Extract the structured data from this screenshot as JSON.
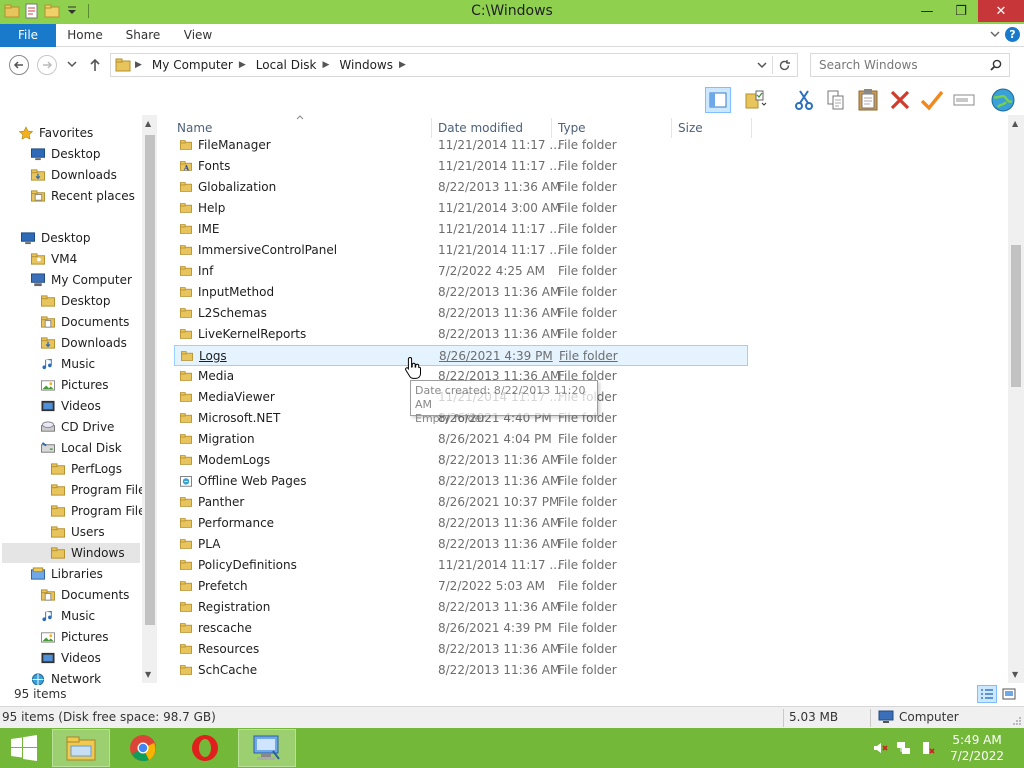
{
  "window": {
    "title": "C:\\Windows",
    "minimize": "—",
    "maximize": "❐",
    "close": "✕"
  },
  "ribbon": {
    "tabs": [
      "File",
      "Home",
      "Share",
      "View"
    ],
    "help": "?"
  },
  "address": {
    "crumbs": [
      "My Computer",
      "Local Disk",
      "Windows"
    ],
    "search_placeholder": "Search Windows"
  },
  "nav": {
    "items": [
      {
        "label": "Favorites",
        "icon": "star-icon"
      },
      {
        "label": "Desktop",
        "icon": "desktop-icon"
      },
      {
        "label": "Downloads",
        "icon": "downloads-icon"
      },
      {
        "label": "Recent places",
        "icon": "recent-places-icon"
      },
      {
        "label": "Desktop",
        "icon": "desktop-icon"
      },
      {
        "label": "VM4",
        "icon": "user-folder-icon"
      },
      {
        "label": "My Computer",
        "icon": "computer-icon"
      },
      {
        "label": "Desktop",
        "icon": "folder-icon"
      },
      {
        "label": "Documents",
        "icon": "documents-icon"
      },
      {
        "label": "Downloads",
        "icon": "downloads-icon"
      },
      {
        "label": "Music",
        "icon": "music-icon"
      },
      {
        "label": "Pictures",
        "icon": "pictures-icon"
      },
      {
        "label": "Videos",
        "icon": "videos-icon"
      },
      {
        "label": "CD Drive",
        "icon": "cd-drive-icon"
      },
      {
        "label": "Local Disk",
        "icon": "disk-icon"
      },
      {
        "label": "PerfLogs",
        "icon": "folder-icon"
      },
      {
        "label": "Program Files",
        "icon": "folder-icon"
      },
      {
        "label": "Program Files",
        "icon": "folder-icon"
      },
      {
        "label": "Users",
        "icon": "folder-icon"
      },
      {
        "label": "Windows",
        "icon": "folder-icon"
      },
      {
        "label": "Libraries",
        "icon": "libraries-icon"
      },
      {
        "label": "Documents",
        "icon": "documents-icon"
      },
      {
        "label": "Music",
        "icon": "music-icon"
      },
      {
        "label": "Pictures",
        "icon": "pictures-icon"
      },
      {
        "label": "Videos",
        "icon": "videos-icon"
      },
      {
        "label": "Network",
        "icon": "network-icon"
      }
    ]
  },
  "columns": {
    "name": "Name",
    "date": "Date modified",
    "type": "Type",
    "size": "Size"
  },
  "files": [
    {
      "name": "FileManager",
      "date": "11/21/2014 11:17 ...",
      "type": "File folder",
      "icon": "folder-icon"
    },
    {
      "name": "Fonts",
      "date": "11/21/2014 11:17 ...",
      "type": "File folder",
      "icon": "fonts-folder-icon"
    },
    {
      "name": "Globalization",
      "date": "8/22/2013 11:36 AM",
      "type": "File folder",
      "icon": "folder-icon"
    },
    {
      "name": "Help",
      "date": "11/21/2014 3:00 AM",
      "type": "File folder",
      "icon": "folder-icon"
    },
    {
      "name": "IME",
      "date": "11/21/2014 11:17 ...",
      "type": "File folder",
      "icon": "folder-icon"
    },
    {
      "name": "ImmersiveControlPanel",
      "date": "11/21/2014 11:17 ...",
      "type": "File folder",
      "icon": "folder-icon"
    },
    {
      "name": "Inf",
      "date": "7/2/2022 4:25 AM",
      "type": "File folder",
      "icon": "folder-icon"
    },
    {
      "name": "InputMethod",
      "date": "8/22/2013 11:36 AM",
      "type": "File folder",
      "icon": "folder-icon"
    },
    {
      "name": "L2Schemas",
      "date": "8/22/2013 11:36 AM",
      "type": "File folder",
      "icon": "folder-icon"
    },
    {
      "name": "LiveKernelReports",
      "date": "8/22/2013 11:36 AM",
      "type": "File folder",
      "icon": "folder-icon"
    },
    {
      "name": "Logs",
      "date": "8/26/2021 4:39 PM",
      "type": "File folder",
      "icon": "folder-icon"
    },
    {
      "name": "Media",
      "date": "8/22/2013 11:36 AM",
      "type": "File folder",
      "icon": "folder-icon"
    },
    {
      "name": "MediaViewer",
      "date": "11/21/2014 11:17 ...",
      "type": "File folder",
      "icon": "folder-icon"
    },
    {
      "name": "Microsoft.NET",
      "date": "8/26/2021 4:40 PM",
      "type": "File folder",
      "icon": "folder-icon"
    },
    {
      "name": "Migration",
      "date": "8/26/2021 4:04 PM",
      "type": "File folder",
      "icon": "folder-icon"
    },
    {
      "name": "ModemLogs",
      "date": "8/22/2013 11:36 AM",
      "type": "File folder",
      "icon": "folder-icon"
    },
    {
      "name": "Offline Web Pages",
      "date": "8/22/2013 11:36 AM",
      "type": "File folder",
      "icon": "offline-pages-icon"
    },
    {
      "name": "Panther",
      "date": "8/26/2021 10:37 PM",
      "type": "File folder",
      "icon": "folder-icon"
    },
    {
      "name": "Performance",
      "date": "8/22/2013 11:36 AM",
      "type": "File folder",
      "icon": "folder-icon"
    },
    {
      "name": "PLA",
      "date": "8/22/2013 11:36 AM",
      "type": "File folder",
      "icon": "folder-icon"
    },
    {
      "name": "PolicyDefinitions",
      "date": "11/21/2014 11:17 ...",
      "type": "File folder",
      "icon": "folder-icon"
    },
    {
      "name": "Prefetch",
      "date": "7/2/2022 5:03 AM",
      "type": "File folder",
      "icon": "folder-icon"
    },
    {
      "name": "Registration",
      "date": "8/22/2013 11:36 AM",
      "type": "File folder",
      "icon": "folder-icon"
    },
    {
      "name": "rescache",
      "date": "8/26/2021 4:39 PM",
      "type": "File folder",
      "icon": "folder-icon"
    },
    {
      "name": "Resources",
      "date": "8/22/2013 11:36 AM",
      "type": "File folder",
      "icon": "folder-icon"
    },
    {
      "name": "SchCache",
      "date": "8/22/2013 11:36 AM",
      "type": "File folder",
      "icon": "folder-icon"
    }
  ],
  "tooltip": {
    "line1": "Date created: 8/22/2013 11:20 AM",
    "line2": "Empty folder"
  },
  "status": {
    "item_count": "95 items",
    "summary": "95 items (Disk free space: 98.7 GB)",
    "size": "5.03 MB",
    "location": "Computer"
  },
  "taskbar": {
    "time": "5:49 AM",
    "date": "7/2/2022"
  },
  "colors": {
    "accent": "#1979ca",
    "titlebar": "#8fd14f",
    "taskbar": "#74b83a",
    "folder": "#e8c45c"
  }
}
